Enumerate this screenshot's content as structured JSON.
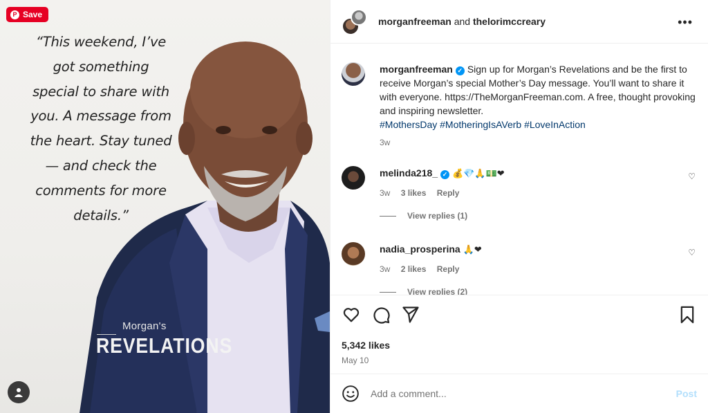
{
  "image": {
    "save_label": "Save",
    "quote": "“This weekend, I’ve\ngot something\nspecial to share with\nyou. A message from\nthe heart. Stay tuned\n— and check the\ncomments for more\ndetails.”",
    "brand_small": "Morgan's",
    "brand_big": "REVELATIONS"
  },
  "header": {
    "user1": "morganfreeman",
    "joiner": "and",
    "user2": "thelorimccreary",
    "more_icon": "•••"
  },
  "caption": {
    "username": "morganfreeman",
    "text": "Sign up for Morgan’s Revelations and be the first to receive Morgan’s special Mother’s Day message. You’ll want to share it with everyone. https://TheMorganFreeman.com. A free, thought provoking and inspiring newsletter.",
    "hashtags": "#MothersDay #MotheringIsAVerb #LoveInAction",
    "time": "3w"
  },
  "comments": [
    {
      "username": "melinda218_",
      "emojis": "💰💎🙏💵❤",
      "time": "3w",
      "likes": "3 likes",
      "reply": "Reply",
      "view_replies": "View replies (1)"
    },
    {
      "username": "nadia_prosperina",
      "emojis": "🙏❤",
      "time": "3w",
      "likes": "2 likes",
      "reply": "Reply",
      "view_replies": "View replies (2)"
    }
  ],
  "actions": {
    "likes": "5,342 likes",
    "date": "May 10"
  },
  "add_comment": {
    "placeholder": "Add a comment...",
    "post_label": "Post"
  },
  "colors": {
    "save_red": "#e60023",
    "verified_blue": "#0095f6",
    "hashtag_blue": "#00376b",
    "post_disabled": "#b2dffc"
  }
}
